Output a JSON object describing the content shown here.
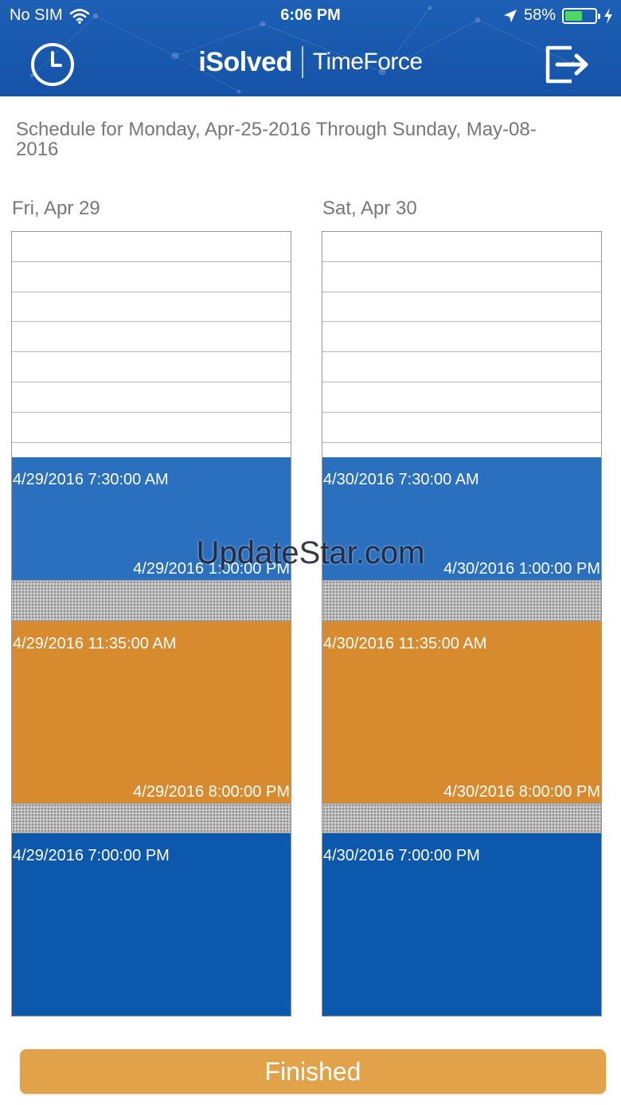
{
  "status_bar": {
    "carrier": "No SIM",
    "time": "6:06 PM",
    "battery": "58%",
    "battery_level": 0.58
  },
  "header": {
    "brand_primary": "iSolved",
    "brand_secondary": "TimeForce",
    "left_icon": "clock-icon",
    "right_icon": "logout-icon",
    "color": "#1a5bb0"
  },
  "schedule": {
    "title": "Schedule for Monday, Apr-25-2016 Through Sunday, May-08-2016",
    "days": [
      {
        "label": "Fri, Apr 29",
        "shifts": [
          {
            "start": "4/29/2016 7:30:00 AM",
            "end": "4/29/2016 1:00:00 PM",
            "color": "#2a70be"
          },
          {
            "start": "4/29/2016 11:35:00 AM",
            "end": "4/29/2016 8:00:00 PM",
            "color": "#d78b2e"
          },
          {
            "start": "4/29/2016 7:00:00 PM",
            "end": "",
            "color": "#0c58ad"
          }
        ]
      },
      {
        "label": "Sat, Apr 30",
        "shifts": [
          {
            "start": "4/30/2016 7:30:00 AM",
            "end": "4/30/2016 1:00:00 PM",
            "color": "#2a70be"
          },
          {
            "start": "4/30/2016 11:35:00 AM",
            "end": "4/30/2016 8:00:00 PM",
            "color": "#d78b2e"
          },
          {
            "start": "4/30/2016 7:00:00 PM",
            "end": "",
            "color": "#0c58ad"
          }
        ]
      }
    ]
  },
  "watermark": "UpdateStar.com",
  "finished_label": "Finished",
  "accent_colors": {
    "finished_button": "#e1a249"
  }
}
